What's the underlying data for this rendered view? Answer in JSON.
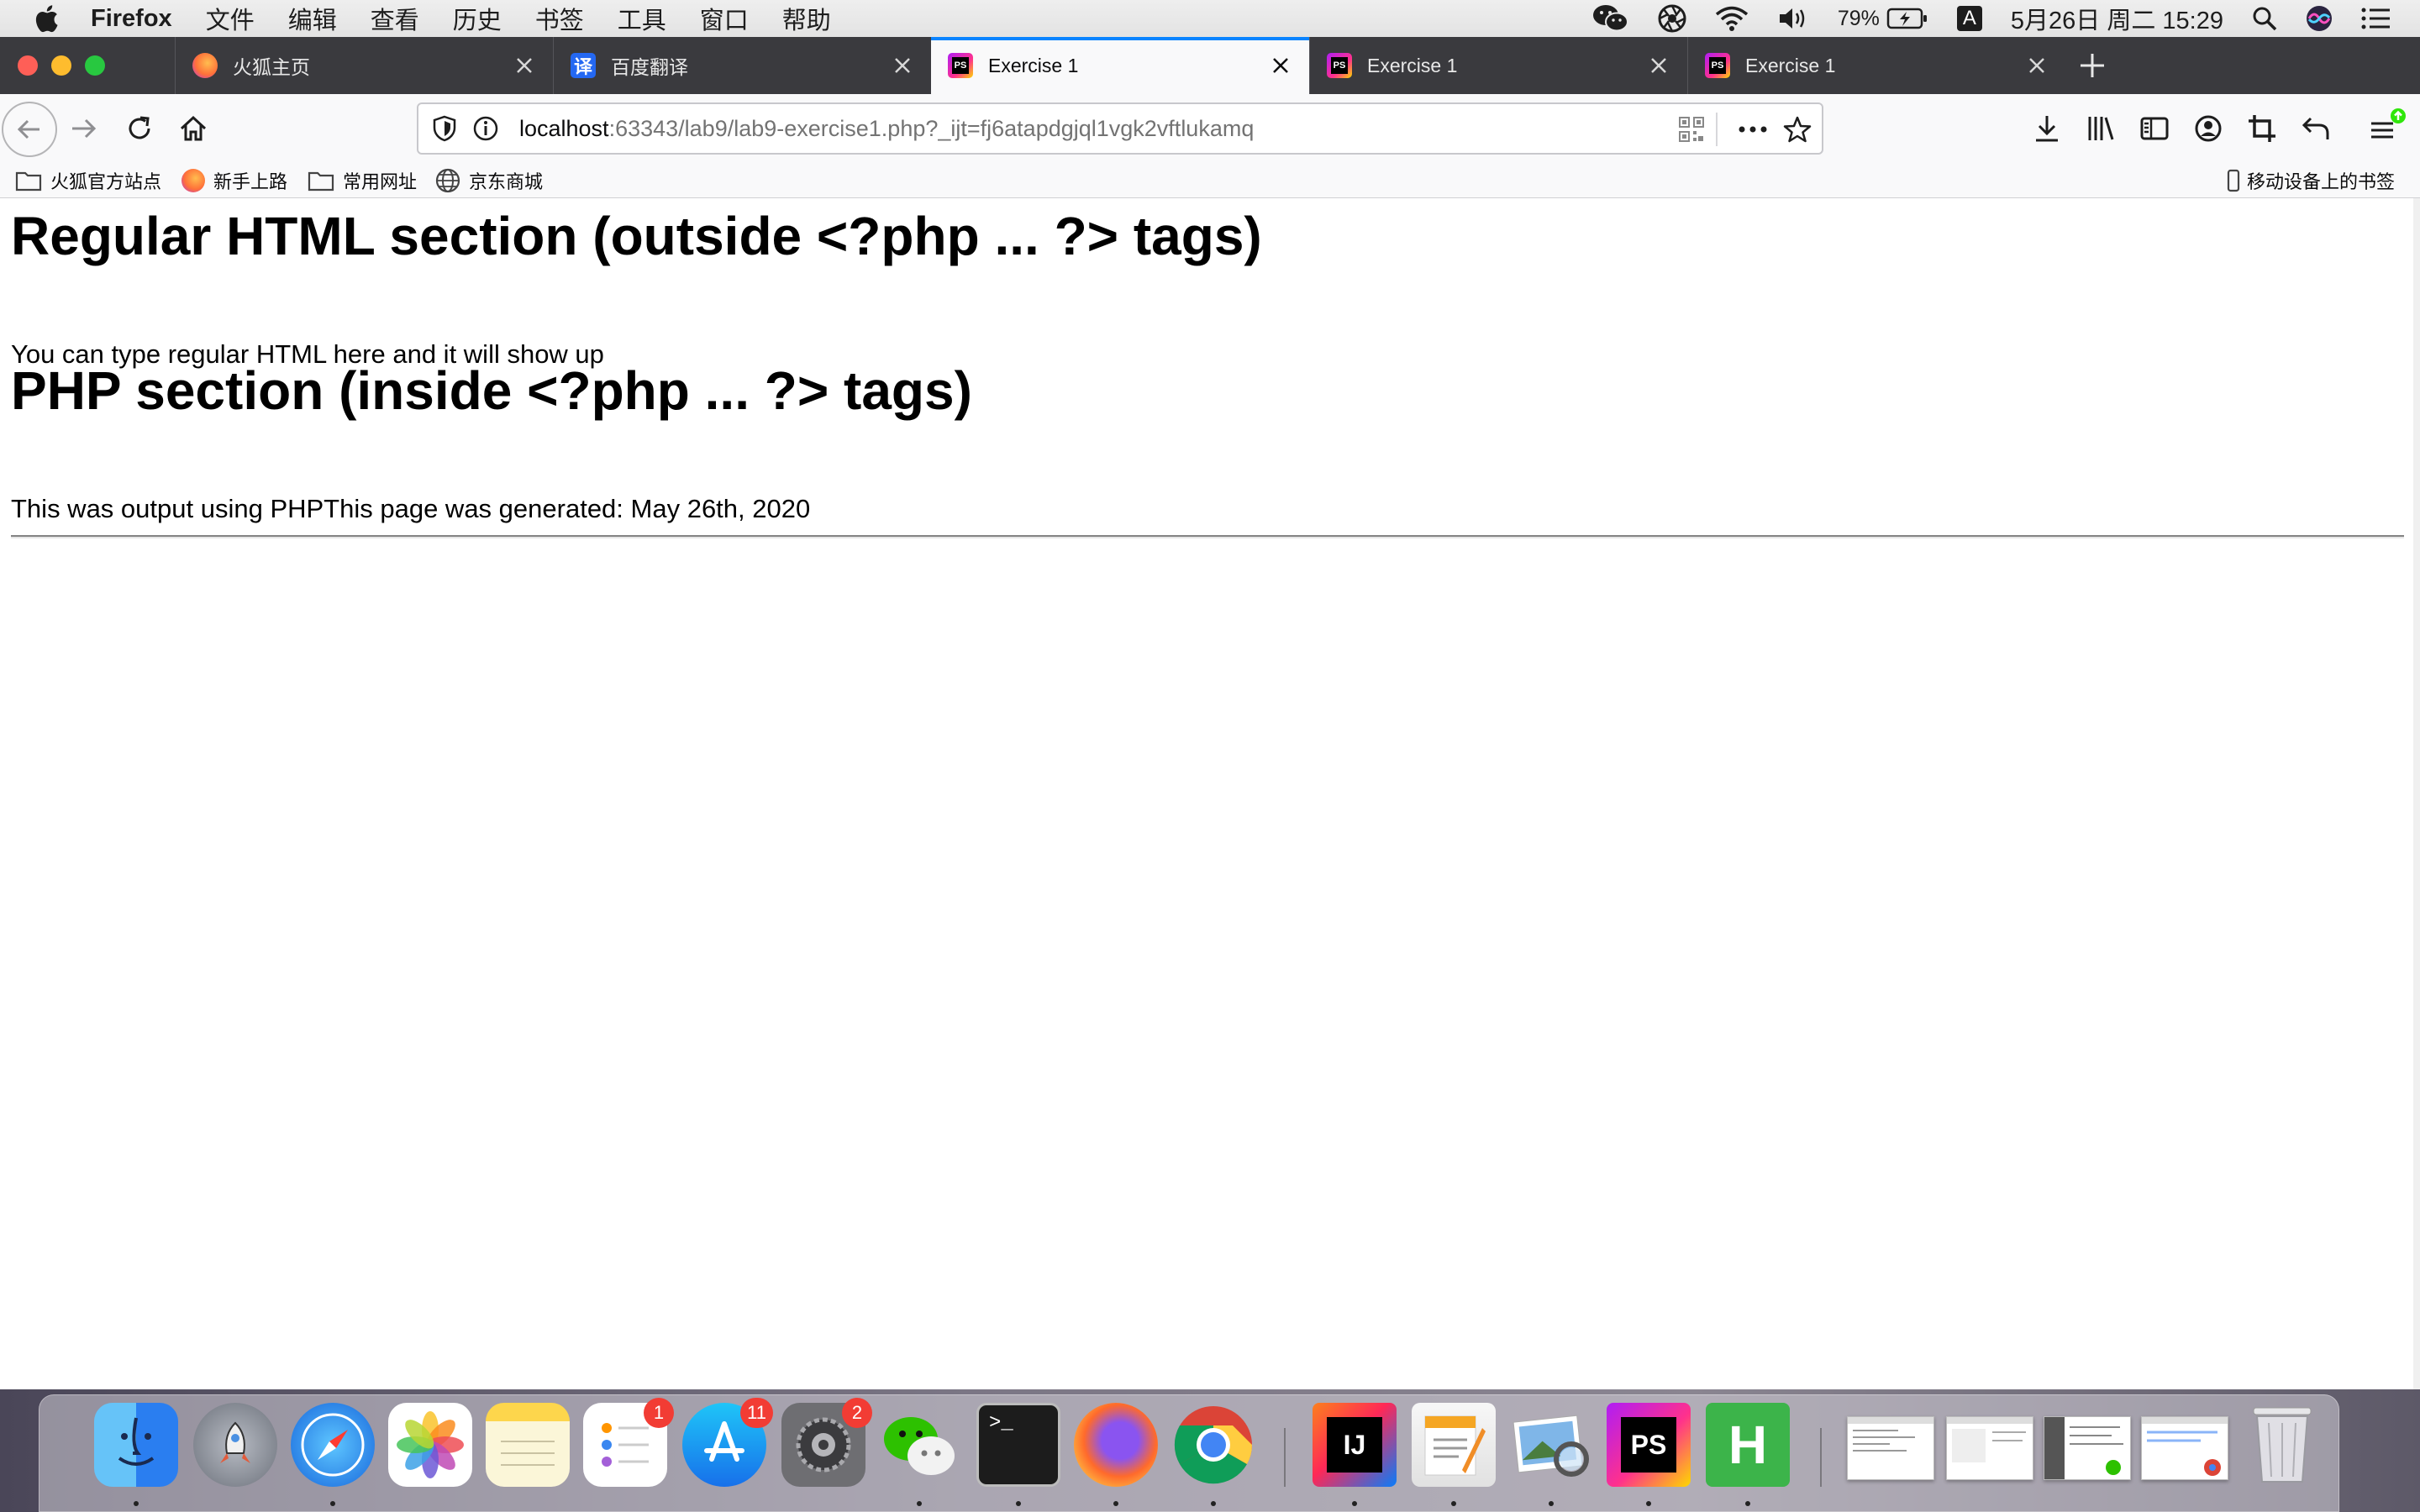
{
  "menubar": {
    "app_name": "Firefox",
    "menus": [
      "文件",
      "编辑",
      "查看",
      "历史",
      "书签",
      "工具",
      "窗口",
      "帮助"
    ],
    "battery": "79%",
    "ime": "A",
    "datetime": "5月26日 周二  15:29"
  },
  "tabs": [
    {
      "title": "火狐主页",
      "icon": "firefox-icon",
      "active": false
    },
    {
      "title": "百度翻译",
      "icon": "translate-icon",
      "favicon_text": "译",
      "active": false
    },
    {
      "title": "Exercise 1",
      "icon": "phpstorm-icon",
      "favicon_text": "PS",
      "active": true
    },
    {
      "title": "Exercise 1",
      "icon": "phpstorm-icon",
      "favicon_text": "PS",
      "active": false
    },
    {
      "title": "Exercise 1",
      "icon": "phpstorm-icon",
      "favicon_text": "PS",
      "active": false
    }
  ],
  "urlbar": {
    "host": "localhost",
    "rest": ":63343/lab9/lab9-exercise1.php?_ijt=fj6atapdgjql1vgk2vftlukamq"
  },
  "bookmarks": {
    "items": [
      {
        "label": "火狐官方站点",
        "icon": "folder-icon"
      },
      {
        "label": "新手上路",
        "icon": "firefox-icon"
      },
      {
        "label": "常用网址",
        "icon": "folder-icon"
      },
      {
        "label": "京东商城",
        "icon": "globe-icon"
      }
    ],
    "mobile": "移动设备上的书签"
  },
  "page": {
    "heading1": "Regular HTML section (outside <?php ... ?> tags)",
    "para1": "You can type regular HTML here and it will show up",
    "heading2": "PHP section (inside <?php ... ?> tags)",
    "para2": "This was output using PHPThis page was generated: May 26th, 2020"
  },
  "dock": {
    "items": [
      "Finder",
      "Launchpad",
      "Safari",
      "Photos",
      "Notes",
      "Reminders",
      "App Store",
      "System Preferences",
      "WeChat",
      "Terminal",
      "Firefox",
      "Chrome",
      "IntelliJ IDEA",
      "Pages",
      "Preview",
      "PhpStorm",
      "HBuilder"
    ],
    "badges": {
      "reminders": "1",
      "appstore": "11",
      "sysprefs": "2"
    },
    "terminal_glyph": ">_",
    "ij_text": "IJ",
    "ps_text": "PS",
    "h_text": "H"
  },
  "colors": {
    "tab_strip": "#3a3a3e",
    "active_tab_line": "#0a84ff",
    "toolbar": "#f9f9fa"
  }
}
